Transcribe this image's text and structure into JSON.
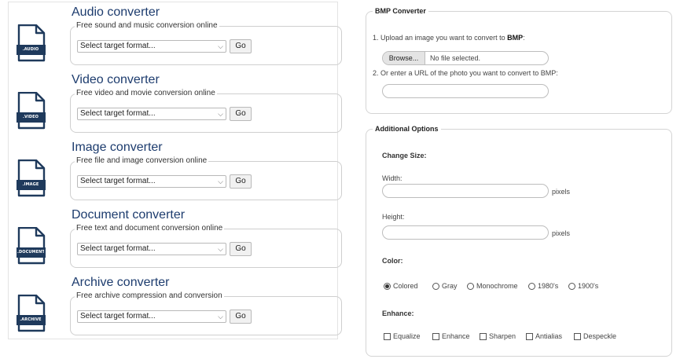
{
  "converters": [
    {
      "title": "Audio converter",
      "subtitle": "Free sound and music conversion online",
      "icon_label": ".AUDIO",
      "select_placeholder": "Select target format...",
      "go_label": "Go"
    },
    {
      "title": "Video converter",
      "subtitle": "Free video and movie conversion online",
      "icon_label": ".VIDEO",
      "select_placeholder": "Select target format...",
      "go_label": "Go"
    },
    {
      "title": "Image converter",
      "subtitle": "Free file and image conversion online",
      "icon_label": ".IMAGE",
      "select_placeholder": "Select target format...",
      "go_label": "Go"
    },
    {
      "title": "Document converter",
      "subtitle": "Free text and document conversion online",
      "icon_label": ".DOCUMENT",
      "select_placeholder": "Select target format...",
      "go_label": "Go"
    },
    {
      "title": "Archive converter",
      "subtitle": "Free archive compression and conversion",
      "icon_label": ".ARCHIVE",
      "select_placeholder": "Select target format...",
      "go_label": "Go"
    }
  ],
  "bmp": {
    "legend": "BMP Converter",
    "step1_text": "1. Upload an image you want to convert to ",
    "step1_bold": "BMP",
    "step1_end": ":",
    "browse_label": "Browse...",
    "file_status": "No file selected.",
    "step2_text": "2. Or enter a URL of the photo you want to convert to BMP:",
    "url_value": ""
  },
  "options": {
    "legend": "Additional Options",
    "change_size_label": "Change Size:",
    "width_label": "Width:",
    "width_value": "",
    "width_unit": "pixels",
    "height_label": "Height:",
    "height_value": "",
    "height_unit": "pixels",
    "color_label": "Color:",
    "color_options": [
      "Colored",
      "Gray",
      "Monochrome",
      "1980's",
      "1900's"
    ],
    "color_selected": "Colored",
    "enhance_label": "Enhance:",
    "enhance_options": [
      "Equalize",
      "Enhance",
      "Sharpen",
      "Antialias",
      "Despeckle"
    ]
  },
  "colors": {
    "title_blue": "#1d3c6e",
    "icon_navy": "#1f3a5c"
  }
}
